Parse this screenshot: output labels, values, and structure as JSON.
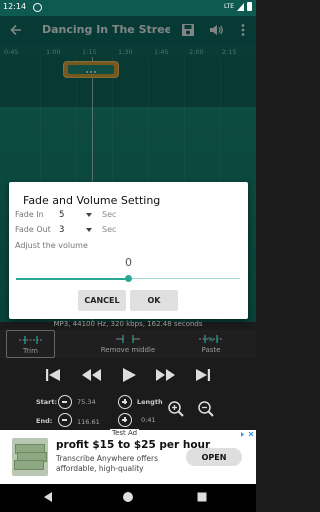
{
  "status": {
    "time": "12:14",
    "network": "LTE"
  },
  "app_bar": {
    "title": "Dancing In The Street..."
  },
  "timeline": {
    "ticks": [
      "0:45",
      "1:00",
      "1:15",
      "1:30",
      "1:45",
      "2:00",
      "2:15"
    ]
  },
  "dialog": {
    "title": "Fade and Volume Setting",
    "fade_in": {
      "label": "Fade In",
      "value": "5",
      "unit": "Sec"
    },
    "fade_out": {
      "label": "Fade Out",
      "value": "3",
      "unit": "Sec"
    },
    "adjust_label": "Adjust the volume",
    "volume_value": "0",
    "volume_fraction": 0.5,
    "cancel_label": "CANCEL",
    "ok_label": "OK"
  },
  "info_line": "MP3, 44100 Hz, 320 kbps, 162.48 seconds",
  "tools": {
    "trim": "Trim",
    "remove_middle": "Remove middle",
    "paste": "Paste"
  },
  "range": {
    "start_label": "Start:",
    "start_value": "75.34",
    "end_label": "End:",
    "end_value": "116.61",
    "length_label": "Length",
    "length_value": "0:41"
  },
  "ad": {
    "label": "Test Ad",
    "headline": "profit $15 to $25 per hour",
    "sub": "Transcribe Anywhere offers affordable, high-quality",
    "cta": "OPEN"
  },
  "colors": {
    "accent": "#2aa897",
    "app_bar": "#0d6b5f",
    "waveform": "#147a6a",
    "marker": "#d8a23a"
  }
}
